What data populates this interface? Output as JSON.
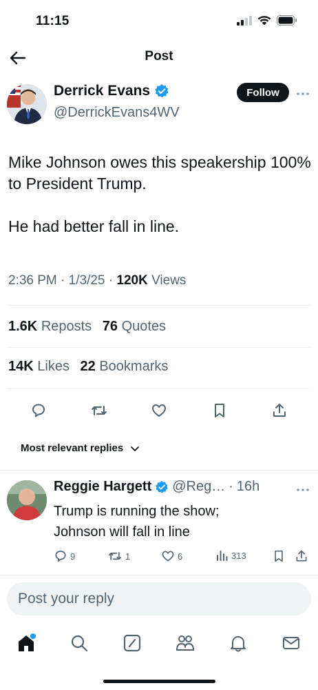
{
  "status_bar": {
    "time": "11:15"
  },
  "header": {
    "title": "Post"
  },
  "post": {
    "author_name": "Derrick Evans",
    "author_handle": "@DerrickEvans4WV",
    "follow_label": "Follow",
    "text": "Mike Johnson owes this speakership 100% to President Trump.\n\nHe had better fall in line.",
    "time": "2:36 PM",
    "date": "1/3/25",
    "views_count": "120K",
    "views_label": "Views",
    "reposts_count": "1.6K",
    "reposts_label": "Reposts",
    "quotes_count": "76",
    "quotes_label": "Quotes",
    "likes_count": "14K",
    "likes_label": "Likes",
    "bookmarks_count": "22",
    "bookmarks_label": "Bookmarks"
  },
  "replies_sort": {
    "label": "Most relevant replies"
  },
  "reply": {
    "author_name": "Reggie Hargett",
    "author_handle": "@Reg…",
    "time": "16h",
    "text": "Trump is running the show;\nJohnson will fall in line",
    "comments": "9",
    "reposts": "1",
    "likes": "6",
    "views": "313"
  },
  "composer": {
    "placeholder": "Post your reply"
  },
  "colors": {
    "accent": "#1d9bf0",
    "text": "#0f1419",
    "muted": "#536471",
    "divider": "#eff3f4"
  },
  "icons": [
    "back-arrow-icon",
    "verified-badge-icon",
    "more-icon",
    "reply-icon",
    "repost-icon",
    "like-icon",
    "bookmark-icon",
    "share-icon",
    "chevron-down-icon",
    "views-icon",
    "home-icon",
    "search-icon",
    "compose-icon",
    "communities-icon",
    "notifications-icon",
    "messages-icon"
  ]
}
